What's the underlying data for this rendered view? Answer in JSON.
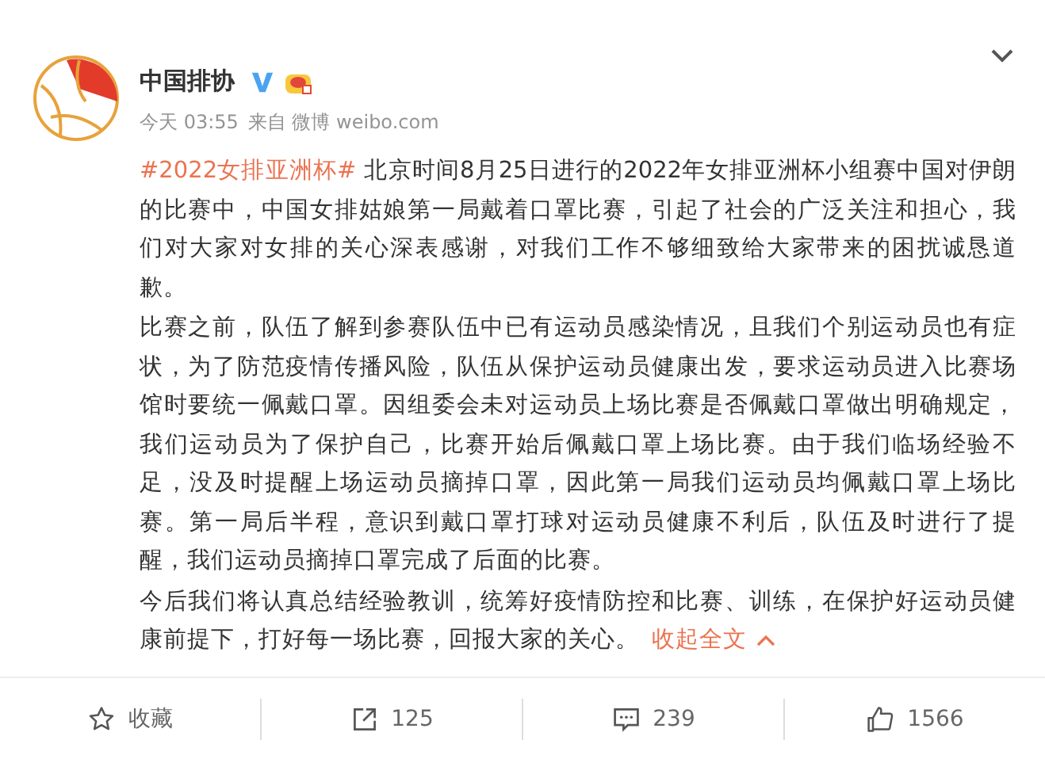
{
  "post": {
    "author": "中国排协",
    "verified": true,
    "time": "今天 03:55",
    "source": "来自 微博 weibo.com",
    "paragraphs": [
      {
        "hashtag": "#2022女排亚洲杯#",
        "text": "北京时间8月25日进行的2022年女排亚洲杯小组赛中国对伊朗的比赛中，中国女排姑娘第一局戴着口罩比赛，引起了社会的广泛关注和担心，我们对大家对女排的关心深表感谢，对我们工作不够细致给大家带来的困扰诚恳道歉。"
      },
      {
        "text": "比赛之前，队伍了解到参赛队伍中已有运动员感染情况，且我们个别运动员也有症状，为了防范疫情传播风险，队伍从保护运动员健康出发，要求运动员进入比赛场馆时要统一佩戴口罩。因组委会未对运动员上场比赛是否佩戴口罩做出明确规定，我们运动员为了保护自己，比赛开始后佩戴口罩上场比赛。由于我们临场经验不足，没及时提醒上场运动员摘掉口罩，因此第一局我们运动员均佩戴口罩上场比赛。第一局后半程，意识到戴口罩打球对运动员健康不利后，队伍及时进行了提醒，我们运动员摘掉口罩完成了后面的比赛。"
      },
      {
        "text": "今后我们将认真总结经验教训，统筹好疫情防控和比赛、训练，在保护好运动员健康前提下，打好每一场比赛，回报大家的关心。",
        "collapse_link": "收起全文"
      }
    ]
  },
  "actions": [
    {
      "kind": "favorite",
      "label": "收藏"
    },
    {
      "kind": "repost",
      "label": "125"
    },
    {
      "kind": "comment",
      "label": "239"
    },
    {
      "kind": "like",
      "label": "1566"
    }
  ]
}
